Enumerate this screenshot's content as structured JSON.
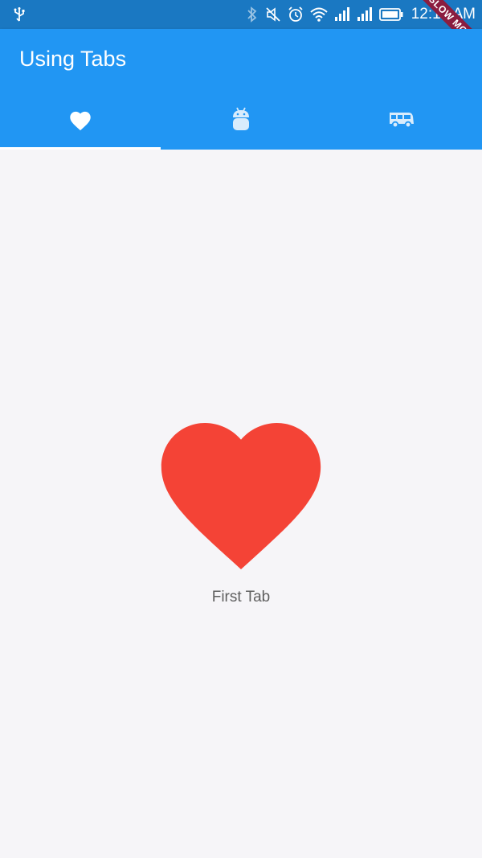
{
  "status_bar": {
    "time": "12:18 AM",
    "debug_banner": "SLOW MODE",
    "left_icon": "usb-icon",
    "right_icons": [
      "bluetooth-icon",
      "mute-icon",
      "alarm-icon",
      "wifi-icon",
      "signal-icon",
      "signal-icon",
      "battery-icon"
    ]
  },
  "app_bar": {
    "title": "Using Tabs",
    "background": "#2196f3"
  },
  "tabs": [
    {
      "icon": "heart-icon",
      "selected": true
    },
    {
      "icon": "android-icon",
      "selected": false
    },
    {
      "icon": "bus-icon",
      "selected": false
    }
  ],
  "content": {
    "icon": "heart-icon",
    "icon_color": "#f44336",
    "label": "First Tab"
  }
}
